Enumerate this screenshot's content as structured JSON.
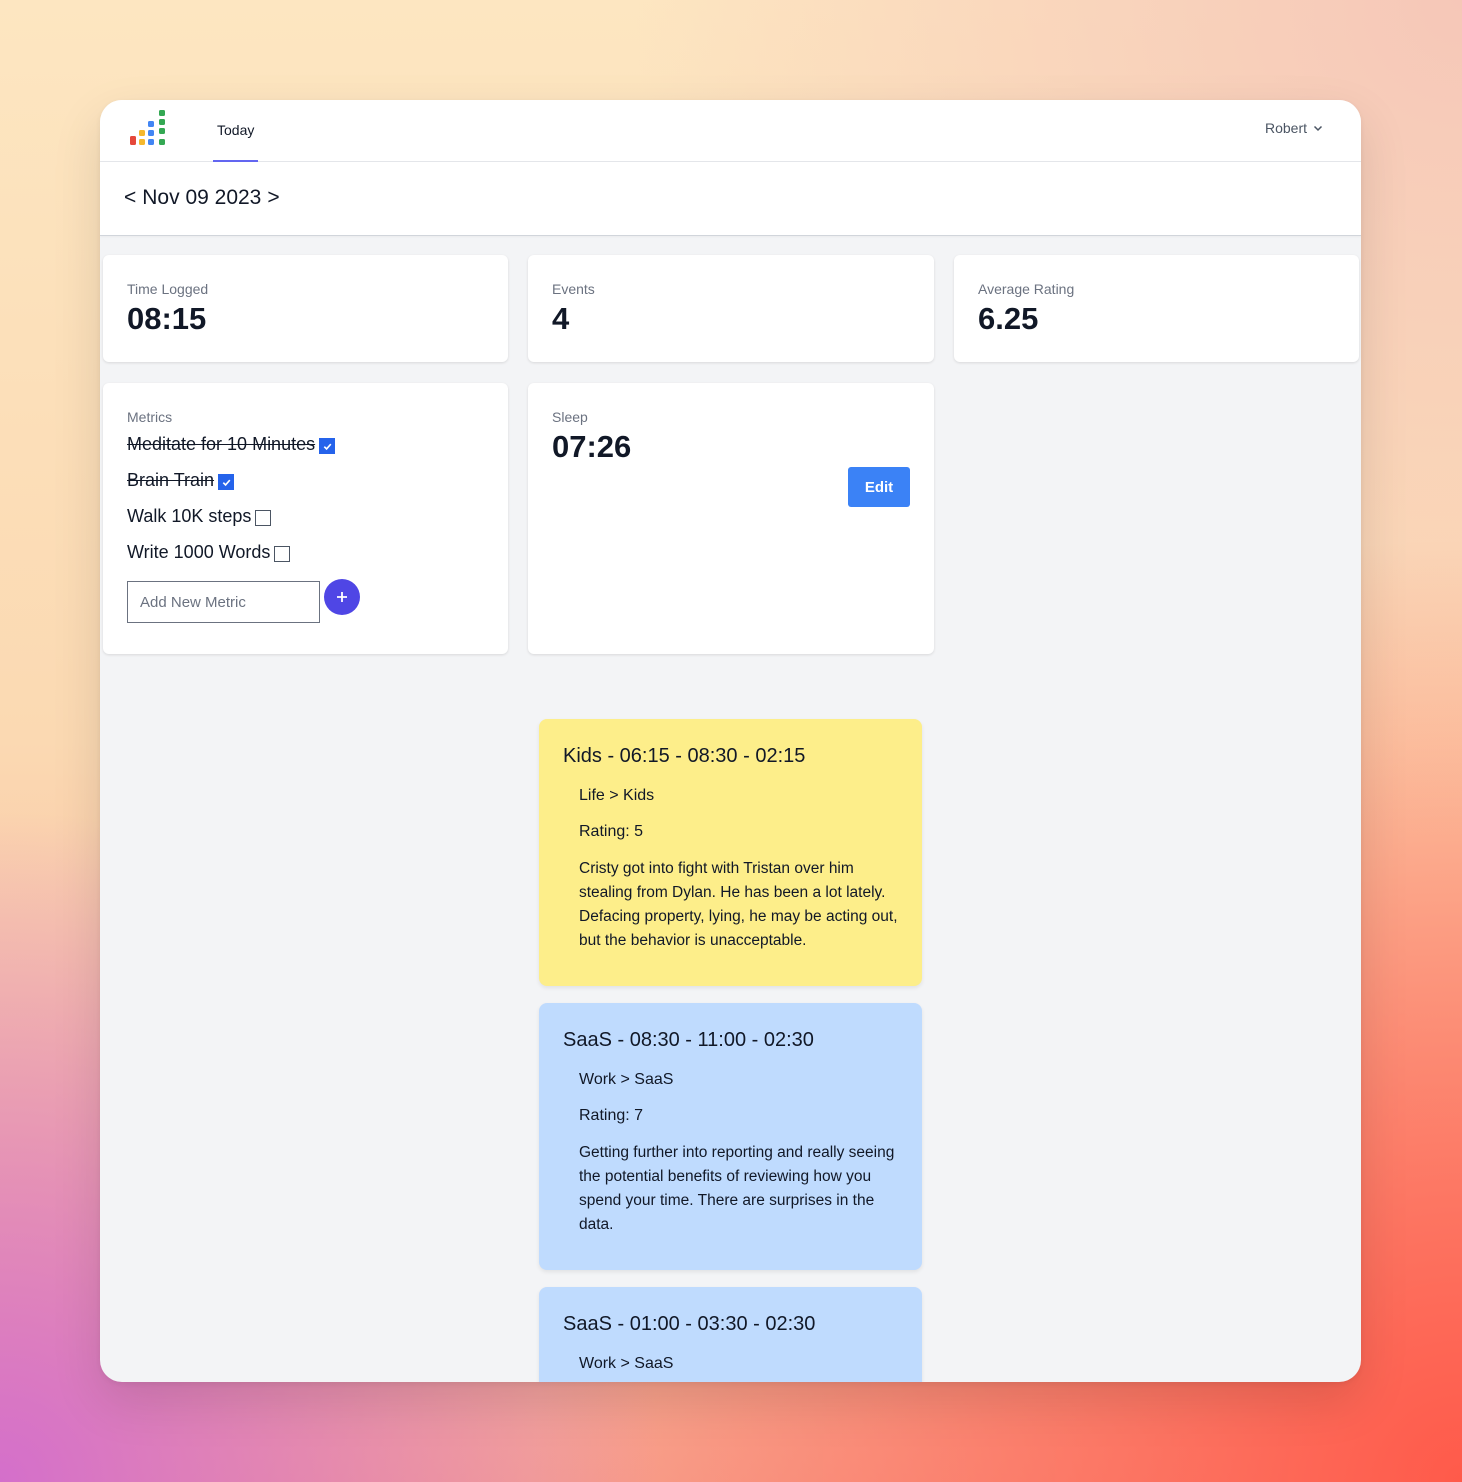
{
  "nav": {
    "tab_today": "Today",
    "user_name": "Robert"
  },
  "date_nav": {
    "prev": "<",
    "date": "Nov 09 2023",
    "next": ">"
  },
  "stats": [
    {
      "label": "Time Logged",
      "value": "08:15"
    },
    {
      "label": "Events",
      "value": "4"
    },
    {
      "label": "Average Rating",
      "value": "6.25"
    }
  ],
  "metrics": {
    "title": "Metrics",
    "items": [
      {
        "label": "Meditate for 10 Minutes",
        "checked": true
      },
      {
        "label": "Brain Train",
        "checked": true
      },
      {
        "label": "Walk 10K steps",
        "checked": false
      },
      {
        "label": "Write 1000 Words",
        "checked": false
      }
    ],
    "input_placeholder": "Add New Metric",
    "add_symbol": "+"
  },
  "sleep": {
    "label": "Sleep",
    "value": "07:26",
    "edit_label": "Edit"
  },
  "events": [
    {
      "title": "Kids - 06:15 - 08:30 - 02:15",
      "category": "Life > Kids",
      "rating": "Rating: 5",
      "description": "Cristy got into fight with Tristan over him stealing from Dylan. He has been a lot lately. Defacing property, lying, he may be acting out, but the behavior is unacceptable.",
      "color": "#fdee8a"
    },
    {
      "title": "SaaS - 08:30 - 11:00 - 02:30",
      "category": "Work > SaaS",
      "rating": "Rating: 7",
      "description": "Getting further into reporting and really seeing the potential benefits of reviewing how you spend your time. There are surprises in the data.",
      "color": "#bfdbfe"
    },
    {
      "title": "SaaS - 01:00 - 03:30 - 02:30",
      "category": "Work > SaaS",
      "color": "#bfdbfe"
    }
  ],
  "colors": {
    "accent": "#6366f1",
    "checkbox": "#2563eb",
    "add_button": "#4f46e5",
    "edit_button": "#3b82f6"
  }
}
